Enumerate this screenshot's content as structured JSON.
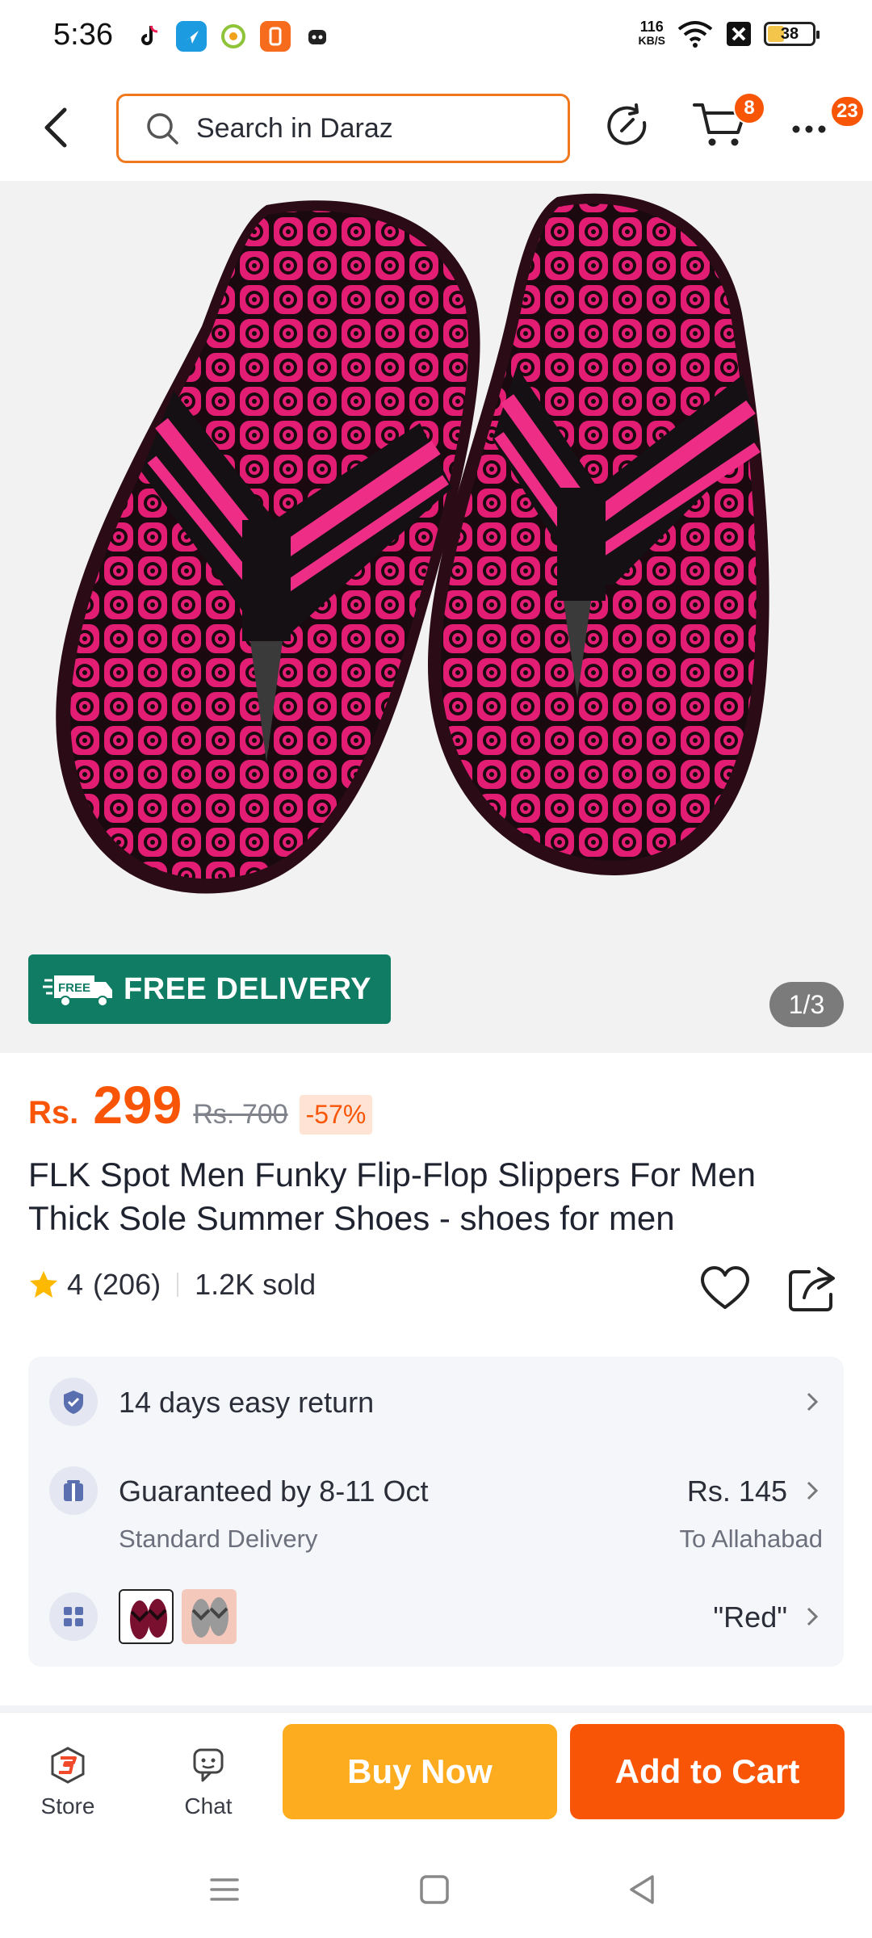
{
  "status_bar": {
    "time": "5:36",
    "net_speed_value": "116",
    "net_speed_unit": "KB/S",
    "battery": "38",
    "notification_icons": [
      "tiktok-icon",
      "bird-app-icon",
      "green-circle-app-icon",
      "orange-app-icon",
      "robot-app-icon"
    ]
  },
  "header": {
    "search_placeholder": "Search in Daraz",
    "cart_count": "8",
    "more_count": "23"
  },
  "gallery": {
    "free_delivery_badge_icon": "FREE",
    "free_delivery_label": "FREE DELIVERY",
    "image_counter": "1/3",
    "product_color": "#e21d73"
  },
  "product": {
    "currency": "Rs.",
    "price": "299",
    "original_price": "Rs. 700",
    "discount": "-57%",
    "title": "FLK Spot Men Funky Flip-Flop Slippers For Men Thick Sole Summer Shoes - shoes for men",
    "rating": "4",
    "review_count": "(206)",
    "sold": "1.2K sold"
  },
  "info": {
    "return_policy": "14 days easy return",
    "delivery_guarantee": "Guaranteed by 8-11 Oct",
    "delivery_type": "Standard Delivery",
    "delivery_fee": "Rs. 145",
    "delivery_location": "To Allahabad",
    "selected_variant": "\"Red\""
  },
  "actions": {
    "store_label": "Store",
    "chat_label": "Chat",
    "buy_now_label": "Buy Now",
    "add_to_cart_label": "Add to Cart"
  },
  "colors": {
    "brand_orange": "#f85606",
    "buy_now": "#fdab1f",
    "free_delivery": "#0f7c63"
  }
}
